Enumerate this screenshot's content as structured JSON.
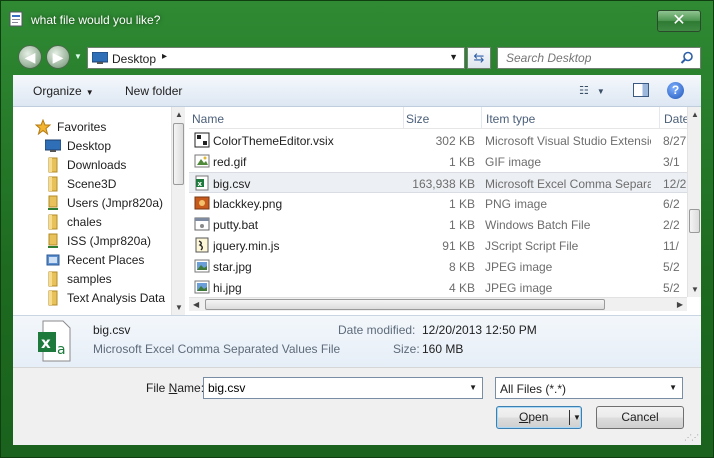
{
  "window": {
    "title": "what file would you like?",
    "close_symbol": "✕"
  },
  "address": {
    "location": "Desktop",
    "separator": "▸"
  },
  "search": {
    "placeholder": "Search Desktop"
  },
  "toolbar": {
    "organize_label": "Organize",
    "new_folder_label": "New folder"
  },
  "nav_items": [
    {
      "label": "Favorites",
      "icon": "star-icon"
    },
    {
      "label": "Desktop",
      "icon": "desktop-icon"
    },
    {
      "label": "Downloads",
      "icon": "folder-icon"
    },
    {
      "label": "Scene3D",
      "icon": "folder-icon"
    },
    {
      "label": "Users (Jmpr820a)",
      "icon": "network-folder-icon"
    },
    {
      "label": "chales",
      "icon": "folder-icon"
    },
    {
      "label": "ISS (Jmpr820a)",
      "icon": "network-folder-icon"
    },
    {
      "label": "Recent Places",
      "icon": "recent-places-icon"
    },
    {
      "label": "samples",
      "icon": "folder-icon"
    },
    {
      "label": "Text Analysis Data",
      "icon": "folder-icon"
    }
  ],
  "columns": {
    "name": "Name",
    "size": "Size",
    "type": "Item type",
    "date": "Date"
  },
  "files": [
    {
      "name": "ColorThemeEditor.vsix",
      "size": "302 KB",
      "type": "Microsoft Visual Studio Extension",
      "date": "8/27",
      "icon": "vsix-icon"
    },
    {
      "name": "red.gif",
      "size": "1 KB",
      "type": "GIF image",
      "date": "3/1",
      "icon": "image-icon"
    },
    {
      "name": "big.csv",
      "size": "163,938 KB",
      "type": "Microsoft Excel Comma Separated...",
      "date": "12/2",
      "icon": "excel-icon",
      "selected": true
    },
    {
      "name": "blackkey.png",
      "size": "1 KB",
      "type": "PNG image",
      "date": "6/2",
      "icon": "png-icon"
    },
    {
      "name": "putty.bat",
      "size": "1 KB",
      "type": "Windows Batch File",
      "date": "2/2",
      "icon": "batch-icon"
    },
    {
      "name": "jquery.min.js",
      "size": "91 KB",
      "type": "JScript Script File",
      "date": "11/",
      "icon": "script-icon"
    },
    {
      "name": "star.jpg",
      "size": "8 KB",
      "type": "JPEG image",
      "date": "5/2",
      "icon": "jpeg-icon"
    },
    {
      "name": "hi.jpg",
      "size": "4 KB",
      "type": "JPEG image",
      "date": "5/2",
      "icon": "jpeg-icon"
    }
  ],
  "details": {
    "name": "big.csv",
    "type": "Microsoft Excel Comma Separated Values File",
    "modified_label": "Date modified:",
    "modified_value": "12/20/2013 12:50 PM",
    "size_label": "Size:",
    "size_value": "160 MB"
  },
  "bottom": {
    "filename_label_underlined": "N",
    "filename_label_prefix": "File ",
    "filename_label_suffix": "ame:",
    "filename_value": "big.csv",
    "filetype_value": "All Files (*.*)",
    "open_label_underlined": "O",
    "open_label_rest": "pen",
    "cancel_label": "Cancel"
  }
}
